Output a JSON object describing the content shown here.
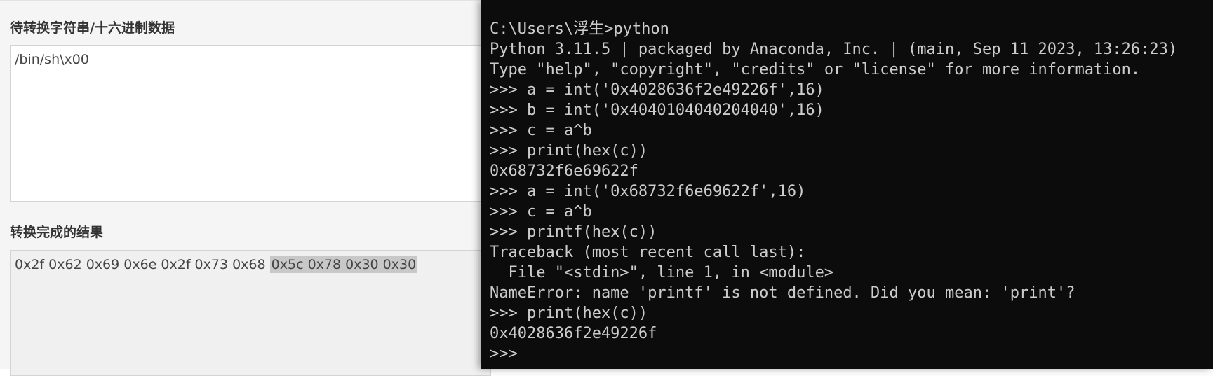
{
  "converter": {
    "input_label": "待转换字符串/十六进制数据",
    "input_value": "/bin/sh\\x00",
    "output_label": "转换完成的结果",
    "output_value": "0x2f 0x62 0x69 0x6e 0x2f 0x73 0x68 ",
    "output_selected": "0x5c 0x78 0x30 0x30"
  },
  "console": {
    "lines": [
      "C:\\Users\\浮生>python",
      "Python 3.11.5 | packaged by Anaconda, Inc. | (main, Sep 11 2023, 13:26:23)",
      "Type \"help\", \"copyright\", \"credits\" or \"license\" for more information.",
      ">>> a = int('0x4028636f2e49226f',16)",
      ">>> b = int('0x4040104040204040',16)",
      ">>> c = a^b",
      ">>> print(hex(c))",
      "0x68732f6e69622f",
      ">>> a = int('0x68732f6e69622f',16)",
      ">>> c = a^b",
      ">>> printf(hex(c))",
      "Traceback (most recent call last):",
      "  File \"<stdin>\", line 1, in <module>",
      "NameError: name 'printf' is not defined. Did you mean: 'print'?",
      ">>> print(hex(c))",
      "0x4028636f2e49226f",
      ">>>"
    ]
  }
}
